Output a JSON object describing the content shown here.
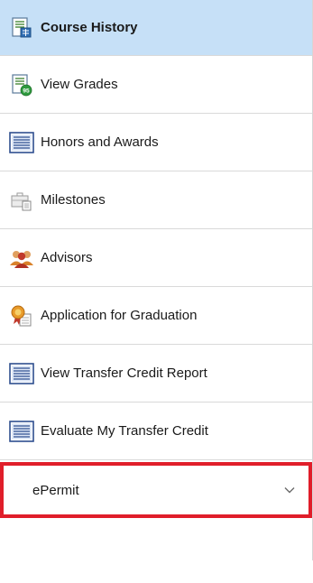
{
  "nav": {
    "items": [
      {
        "label": "Course History",
        "icon": "course-history-icon",
        "selected": true
      },
      {
        "label": "View Grades",
        "icon": "view-grades-icon",
        "selected": false
      },
      {
        "label": "Honors and Awards",
        "icon": "document-list-icon",
        "selected": false
      },
      {
        "label": "Milestones",
        "icon": "milestones-icon",
        "selected": false
      },
      {
        "label": "Advisors",
        "icon": "advisors-icon",
        "selected": false
      },
      {
        "label": "Application for Graduation",
        "icon": "graduation-ribbon-icon",
        "selected": false
      },
      {
        "label": "View Transfer Credit Report",
        "icon": "document-list-icon",
        "selected": false
      },
      {
        "label": "Evaluate My Transfer Credit",
        "icon": "document-list-icon",
        "selected": false
      }
    ],
    "expand_item": {
      "label": "ePermit",
      "icon": "chevron-down-icon",
      "highlight_color": "#e01e2a"
    }
  },
  "colors": {
    "selected_bg": "#c6e0f7",
    "divider": "#d9d9d9",
    "highlight": "#e01e2a"
  }
}
